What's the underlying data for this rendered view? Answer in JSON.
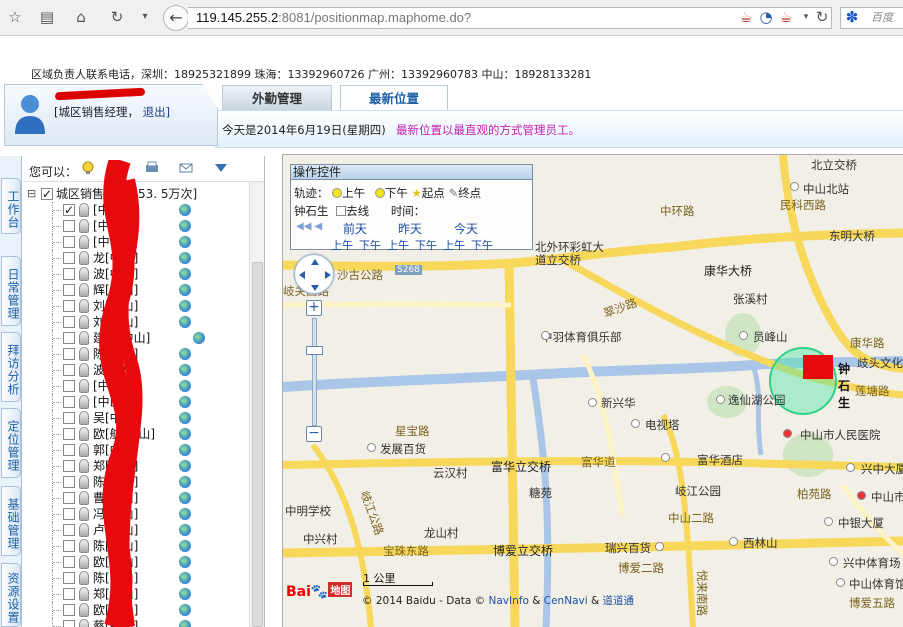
{
  "browser": {
    "url_host": "119.145.255.2",
    "url_rest": ":8081/positionmap.maphome.do?",
    "search_placeholder": "百度"
  },
  "header": {
    "contact": "区域负责人联系电话，深圳：18925321899   珠海：13392960726   广州：13392960783   中山：18928133281",
    "user_role": "[城区销售经理，",
    "logout": "退出]",
    "tabs": [
      {
        "label": "外勤管理",
        "active": false
      },
      {
        "label": "最新位置",
        "active": true
      }
    ],
    "today": "今天是2014年6月19日(星期四)",
    "hint": "最新位置以最直观的方式管理员工。"
  },
  "left_nav": [
    "工作台",
    "日常管理",
    "拜访分析",
    "定位管理",
    "基础管理",
    "资源设置"
  ],
  "tree": {
    "prompt": "您可以：",
    "root": "城区销售",
    "root_suffix": "53. 5万次]",
    "rows": [
      {
        "label": "[中山]",
        "checked": true
      },
      {
        "label": "[中山]",
        "checked": false
      },
      {
        "label": "[中山]",
        "checked": false
      },
      {
        "label": "龙[中山]",
        "checked": false
      },
      {
        "label": "波[中山]",
        "checked": false
      },
      {
        "label": "辉[中山]",
        "checked": false
      },
      {
        "label": "刘[中山]",
        "checked": false
      },
      {
        "label": "刘[中山]",
        "checked": false
      },
      {
        "label": "建航[中山]",
        "checked": false
      },
      {
        "label": "陈[中山]",
        "checked": false
      },
      {
        "label": "波[惠州]",
        "checked": false
      },
      {
        "label": "[中山]",
        "checked": false
      },
      {
        "label": "[中山]",
        "checked": false
      },
      {
        "label": "吴[中山]",
        "checked": false
      },
      {
        "label": "欧[航[中山]",
        "checked": false
      },
      {
        "label": "郭[中山]",
        "checked": false
      },
      {
        "label": "郑[中山]",
        "checked": false
      },
      {
        "label": "陈[中山]",
        "checked": false
      },
      {
        "label": "曹[中山]",
        "checked": false
      },
      {
        "label": "冯[中山]",
        "checked": false
      },
      {
        "label": "卢[中山]",
        "checked": false
      },
      {
        "label": "陈[中山]",
        "checked": false
      },
      {
        "label": "欧[中山]",
        "checked": false
      },
      {
        "label": "陈[中山]",
        "checked": false
      },
      {
        "label": "郑[中山]",
        "checked": false
      },
      {
        "label": "欧[中山]",
        "checked": false
      },
      {
        "label": "蔡[中山]",
        "checked": false
      }
    ]
  },
  "map_control": {
    "title": "操作控件",
    "track_label": "轨迹：",
    "am": "上午",
    "pm": "下午",
    "start": "起点",
    "end": "终点",
    "person": "钟石生",
    "goline": "去线",
    "time_label": "时间：",
    "days": [
      "前天",
      "昨天",
      "今天"
    ],
    "halves": [
      "上午",
      "下午",
      "上午",
      "下午",
      "上午",
      "下午"
    ]
  },
  "map": {
    "labels": [
      "北立交桥",
      "中山北站",
      "东明大桥",
      "民科西路",
      "中环路",
      "北外环彩虹大道立交桥",
      "康华大桥",
      "沙古公路",
      "S268",
      "岐关西路",
      "翠沙路",
      "中羽体育俱乐部",
      "员峰山",
      "张溪村",
      "康华路",
      "歧头文化",
      "莲塘路",
      "新兴华",
      "电视塔",
      "逸仙湖公园",
      "中山市人民医院",
      "星宝路",
      "发展百货",
      "兴中大厦",
      "云汉村",
      "富华立交桥",
      "富华道",
      "富华酒店",
      "岐江公园",
      "柏苑路",
      "中山市",
      "糖苑",
      "中银大厦",
      "中山二路",
      "中明学校",
      "龙山村",
      "瑞兴百货",
      "西林山",
      "兴中体育场",
      "宝珠东路",
      "博爱立交桥",
      "博爱二路",
      "中山体育馆",
      "中兴村",
      "岐江公路",
      "悦来南路",
      "博爱五路",
      "钟石生"
    ],
    "scale": "1 公里",
    "copyright_prefix": "© 2014 Baidu - Data ©",
    "navinfo": "NavInfo",
    "amp1": "&",
    "cennavi": "CenNavi",
    "amp2": "&",
    "daodao": "道道通",
    "baidu_logo": "Bai",
    "baidu_paw": "du",
    "baidu_map": "地图"
  },
  "colors": {
    "accent": "#1e5fa8",
    "hint": "#c21fb3",
    "marker": "#e8090f",
    "road_yellow": "#f7d85a",
    "river": "#a9c6e8"
  }
}
